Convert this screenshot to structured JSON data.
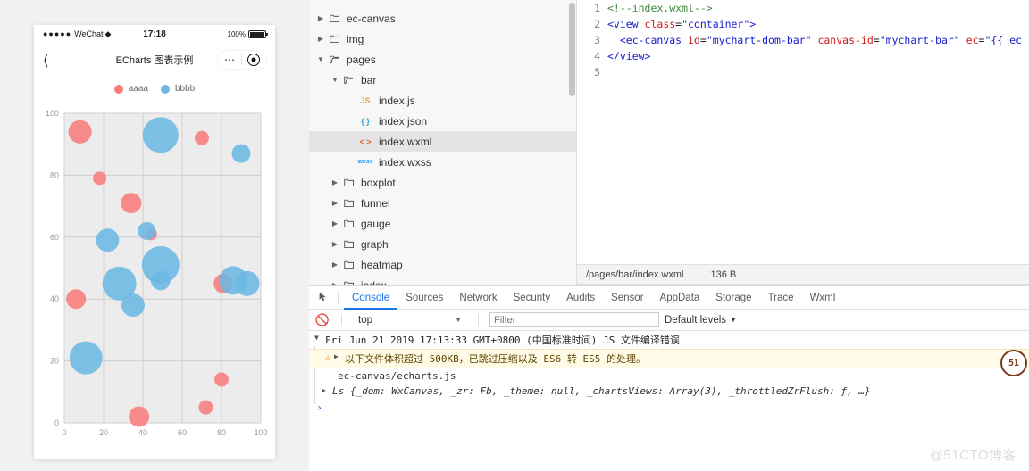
{
  "simulator": {
    "status_bar": {
      "signal_dots": "●●●●●",
      "carrier": "WeChat",
      "wifi_icon": "wifi-icon",
      "time": "17:18",
      "battery_percent": "100%",
      "battery_icon": "battery-icon"
    },
    "nav_bar": {
      "back_icon": "chevron-left-icon",
      "title": "ECharts 图表示例",
      "more_icon": "ellipsis-icon",
      "target_icon": "target-icon"
    },
    "legend": [
      {
        "label": "aaaa",
        "color": "#f87c7c"
      },
      {
        "label": "bbbb",
        "color": "#6cb8e4"
      }
    ]
  },
  "chart_data": {
    "type": "scatter",
    "title": "",
    "xlabel": "",
    "ylabel": "",
    "xlim": [
      0,
      100
    ],
    "ylim": [
      0,
      100
    ],
    "xticks": [
      0,
      20,
      40,
      60,
      80,
      100
    ],
    "yticks": [
      0,
      20,
      40,
      60,
      80,
      100
    ],
    "grid": true,
    "legend_position": "top",
    "series": [
      {
        "name": "aaaa",
        "color": "#f87c7c",
        "points": [
          {
            "x": 8,
            "y": 94,
            "size": 26
          },
          {
            "x": 70,
            "y": 92,
            "size": 16
          },
          {
            "x": 18,
            "y": 79,
            "size": 15
          },
          {
            "x": 34,
            "y": 71,
            "size": 23
          },
          {
            "x": 6,
            "y": 40,
            "size": 22
          },
          {
            "x": 81,
            "y": 45,
            "size": 22
          },
          {
            "x": 38,
            "y": 2,
            "size": 23
          },
          {
            "x": 80,
            "y": 14,
            "size": 16
          },
          {
            "x": 72,
            "y": 5,
            "size": 16
          },
          {
            "x": 44,
            "y": 61,
            "size": 14
          }
        ]
      },
      {
        "name": "bbbb",
        "color": "#6cb8e4",
        "points": [
          {
            "x": 49,
            "y": 93,
            "size": 40
          },
          {
            "x": 90,
            "y": 87,
            "size": 21
          },
          {
            "x": 42,
            "y": 62,
            "size": 20
          },
          {
            "x": 22,
            "y": 59,
            "size": 26
          },
          {
            "x": 49,
            "y": 51,
            "size": 42
          },
          {
            "x": 28,
            "y": 45,
            "size": 38
          },
          {
            "x": 86,
            "y": 46,
            "size": 32
          },
          {
            "x": 93,
            "y": 45,
            "size": 28
          },
          {
            "x": 35,
            "y": 38,
            "size": 26
          },
          {
            "x": 11,
            "y": 21,
            "size": 37
          },
          {
            "x": 49,
            "y": 46,
            "size": 22
          }
        ]
      }
    ]
  },
  "explorer": {
    "items": [
      {
        "label": "ec-canvas",
        "type": "folder",
        "depth": 0,
        "expanded": false,
        "selected": false
      },
      {
        "label": "img",
        "type": "folder",
        "depth": 0,
        "expanded": false,
        "selected": false
      },
      {
        "label": "pages",
        "type": "folder",
        "depth": 0,
        "expanded": true,
        "selected": false
      },
      {
        "label": "bar",
        "type": "folder",
        "depth": 1,
        "expanded": true,
        "selected": false
      },
      {
        "label": "index.js",
        "type": "js",
        "depth": 2,
        "expanded": null,
        "selected": false
      },
      {
        "label": "index.json",
        "type": "json",
        "depth": 2,
        "expanded": null,
        "selected": false
      },
      {
        "label": "index.wxml",
        "type": "wxml",
        "depth": 2,
        "expanded": null,
        "selected": true
      },
      {
        "label": "index.wxss",
        "type": "wxss",
        "depth": 2,
        "expanded": null,
        "selected": false
      },
      {
        "label": "boxplot",
        "type": "folder",
        "depth": 1,
        "expanded": false,
        "selected": false
      },
      {
        "label": "funnel",
        "type": "folder",
        "depth": 1,
        "expanded": false,
        "selected": false
      },
      {
        "label": "gauge",
        "type": "folder",
        "depth": 1,
        "expanded": false,
        "selected": false
      },
      {
        "label": "graph",
        "type": "folder",
        "depth": 1,
        "expanded": false,
        "selected": false
      },
      {
        "label": "heatmap",
        "type": "folder",
        "depth": 1,
        "expanded": false,
        "selected": false
      },
      {
        "label": "index",
        "type": "folder",
        "depth": 1,
        "expanded": false,
        "selected": false
      }
    ]
  },
  "editor": {
    "lines": [
      {
        "no": "1",
        "segments": [
          {
            "t": "<!--index.wxml-->",
            "c": "c-com"
          }
        ]
      },
      {
        "no": "2",
        "segments": [
          {
            "t": "<view ",
            "c": "c-tag"
          },
          {
            "t": "class",
            "c": "c-attr"
          },
          {
            "t": "=",
            "c": "c-plain"
          },
          {
            "t": "\"container\"",
            "c": "c-val"
          },
          {
            "t": ">",
            "c": "c-tag"
          }
        ]
      },
      {
        "no": "3",
        "segments": [
          {
            "t": "  <ec-canvas ",
            "c": "c-tag"
          },
          {
            "t": "id",
            "c": "c-attr"
          },
          {
            "t": "=",
            "c": "c-plain"
          },
          {
            "t": "\"mychart-dom-bar\"",
            "c": "c-val"
          },
          {
            "t": " ",
            "c": "c-plain"
          },
          {
            "t": "canvas-id",
            "c": "c-attr"
          },
          {
            "t": "=",
            "c": "c-plain"
          },
          {
            "t": "\"mychart-bar\"",
            "c": "c-val"
          },
          {
            "t": " ",
            "c": "c-plain"
          },
          {
            "t": "ec",
            "c": "c-attr"
          },
          {
            "t": "=",
            "c": "c-plain"
          },
          {
            "t": "\"{{ ec",
            "c": "c-val"
          }
        ]
      },
      {
        "no": "4",
        "segments": [
          {
            "t": "</view>",
            "c": "c-tag"
          }
        ]
      },
      {
        "no": "5",
        "segments": []
      }
    ],
    "status": {
      "path": "/pages/bar/index.wxml",
      "size": "136 B"
    }
  },
  "devtools": {
    "inspect_icon": "inspect-element-icon",
    "tabs": [
      {
        "label": "Console",
        "active": true
      },
      {
        "label": "Sources",
        "active": false
      },
      {
        "label": "Network",
        "active": false
      },
      {
        "label": "Security",
        "active": false
      },
      {
        "label": "Audits",
        "active": false
      },
      {
        "label": "Sensor",
        "active": false
      },
      {
        "label": "AppData",
        "active": false
      },
      {
        "label": "Storage",
        "active": false
      },
      {
        "label": "Trace",
        "active": false
      },
      {
        "label": "Wxml",
        "active": false
      }
    ],
    "toolbar": {
      "clear_icon": "clear-console-icon",
      "context": "top",
      "context_caret": "caret-down-icon",
      "filter_placeholder": "Filter",
      "levels": "Default levels",
      "levels_caret": "caret-down-icon"
    },
    "console": {
      "group_header": "Fri Jun 21 2019 17:13:33 GMT+0800 (中国标准时间) JS 文件编译错误",
      "warning": "以下文件体积超过 500KB，已跳过压缩以及 ES6 转 ES5 的处理。",
      "warning_icon": "warning-triangle-icon",
      "warning_detail": "ec-canvas/echarts.js",
      "object_line": "Ls {_dom: WxCanvas, _zr: Fb, _theme: null, _chartsViews: Array(3), _throttledZrFlush: ƒ, …}",
      "prompt": "›",
      "badge": "51"
    }
  },
  "watermark": "@51CTO博客"
}
